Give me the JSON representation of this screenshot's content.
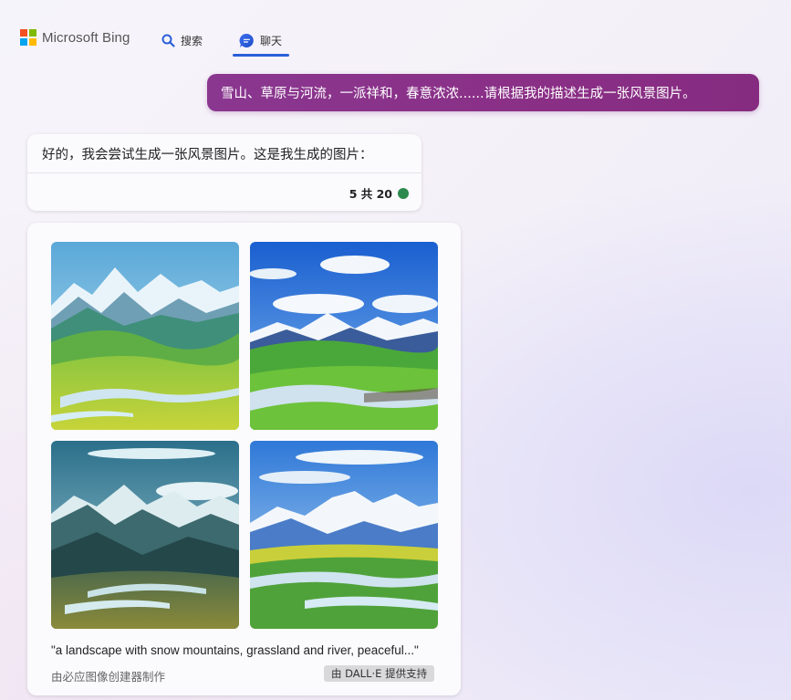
{
  "header": {
    "brand": "Microsoft Bing",
    "tabs": [
      {
        "label": "搜索",
        "icon": "search-icon"
      },
      {
        "label": "聊天",
        "icon": "chat-icon",
        "active": true
      }
    ]
  },
  "conversation": {
    "user_message": "雪山、草原与河流，一派祥和，春意浓浓......请根据我的描述生成一张风景图片。",
    "bot_message": "好的，我会尝试生成一张风景图片。这是我生成的图片：",
    "turn_counter": "5 共 20",
    "turn_status_color": "#2d8a4e"
  },
  "image_result": {
    "prompt": "\"a landscape with snow mountains, grassland and river, peaceful...\"",
    "creator_label": "由必应图像创建器制作",
    "provider_badge": "由 DALL·E 提供支持",
    "images": [
      {
        "name": "generated-image-1"
      },
      {
        "name": "generated-image-2"
      },
      {
        "name": "generated-image-3"
      },
      {
        "name": "generated-image-4"
      }
    ]
  },
  "colors": {
    "user_bubble": "#8a3790",
    "active_tab": "#2b5fd9",
    "ms_red": "#f25022",
    "ms_green": "#7fba00",
    "ms_blue": "#00a4ef",
    "ms_yellow": "#ffb900"
  }
}
